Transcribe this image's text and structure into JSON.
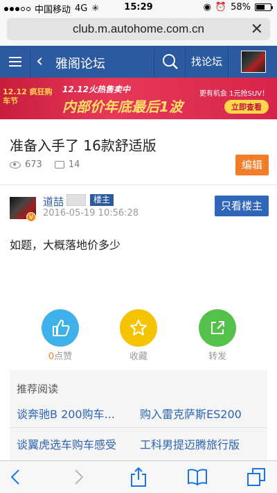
{
  "status": {
    "carrier": "中国移动",
    "network": "4G",
    "time": "15:29",
    "battery": "58%",
    "battery_level": 0.58
  },
  "browser": {
    "url": "club.m.autohome.com.cn"
  },
  "nav": {
    "title": "雅阁论坛",
    "find_forum": "找论坛"
  },
  "banner": {
    "tag": "12.12 疯狂购车节",
    "sub": "12.12火热售卖中",
    "main": "内部价年底最后1波",
    "promo": "更有机会 1元抢SUV！",
    "cta": "立即查看"
  },
  "post": {
    "title": "准备入手了 16款舒适版",
    "views": "673",
    "comments": "14",
    "edit": "编辑"
  },
  "author": {
    "name": "道喆",
    "badge": "楼主",
    "date": "2016-05-19 10:56:28",
    "verified": "V",
    "only_owner": "只看楼主"
  },
  "content": "如题，大概落地价多少",
  "actions": {
    "like_count": "0",
    "like": "点赞",
    "fav": "收藏",
    "share": "转发"
  },
  "recommend": {
    "heading": "推荐阅读",
    "items": [
      "谈奔驰B 200购车...",
      "购入雷克萨斯ES200",
      "谈翼虎选车购车感受",
      "工科男提迈腾旅行版"
    ]
  },
  "colors": {
    "nav": "#2c5aa0",
    "orange": "#f27c28",
    "like": "#3fb1ea",
    "fav": "#f5c400",
    "share": "#54c24a"
  }
}
